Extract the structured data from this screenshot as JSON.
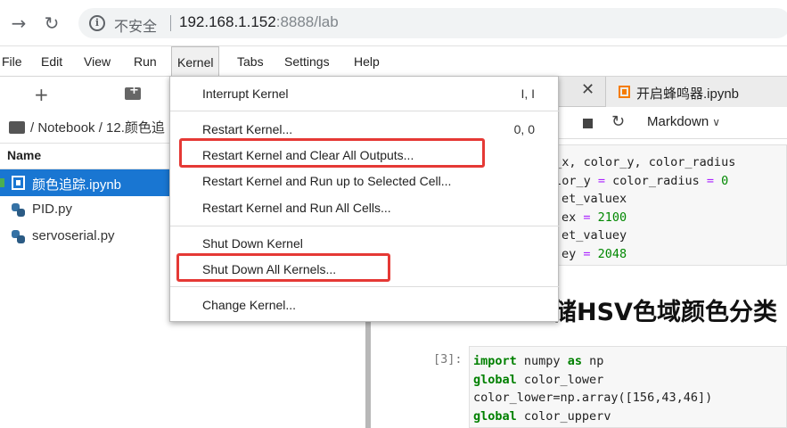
{
  "browser": {
    "not_secure": "不安全",
    "url_host": "192.168.1.152",
    "url_port": ":8888/lab"
  },
  "menubar": {
    "items": [
      "File",
      "Edit",
      "View",
      "Run",
      "Kernel",
      "Tabs",
      "Settings",
      "Help"
    ]
  },
  "filebrowser": {
    "breadcrumb": "/ Notebook / 12.颜色追",
    "header_name": "Name",
    "files": [
      {
        "name": "颜色追踪.ipynb",
        "type": "notebook"
      },
      {
        "name": "PID.py",
        "type": "python"
      },
      {
        "name": "servoserial.py",
        "type": "python"
      }
    ]
  },
  "tabs": {
    "active_label": "开启蜂鸣器.ipynb"
  },
  "notebook_toolbar": {
    "cell_type": "Markdown"
  },
  "notebook": {
    "code_cell_1": [
      {
        "t": "r_x, color_y, color_radius"
      },
      {
        "t": "olor_y ",
        "eq": "=",
        "t2": " color_radius ",
        "eq2": "=",
        "n": " 0"
      },
      {
        "t": "et_valuex"
      },
      {
        "t": "ex ",
        "eq": "=",
        "n": " 2100"
      },
      {
        "t": "et_valuey"
      },
      {
        "t": "ey ",
        "eq": "=",
        "n": " 2048"
      }
    ],
    "heading": "储HSV色域颜色分类",
    "prompt": "[3]:",
    "code_cell_2": {
      "line1_kw": "import",
      "line1_rest": " numpy ",
      "line1_kw2": "as",
      "line1_rest2": " np",
      "line2_kw": "global",
      "line2_rest": " color_lower",
      "line3": "color_lower=np.array([156,43,46])",
      "line4_kw": "global",
      "line4_rest": " color_upperv"
    }
  },
  "kernel_menu": {
    "items": [
      {
        "label": "Interrupt Kernel",
        "shortcut": "I, I"
      },
      {
        "label": "Restart Kernel...",
        "shortcut": "0, 0"
      },
      {
        "label": "Restart Kernel and Clear All Outputs...",
        "shortcut": ""
      },
      {
        "label": "Restart Kernel and Run up to Selected Cell...",
        "shortcut": ""
      },
      {
        "label": "Restart Kernel and Run All Cells...",
        "shortcut": ""
      },
      {
        "label": "Shut Down Kernel",
        "shortcut": ""
      },
      {
        "label": "Shut Down All Kernels...",
        "shortcut": ""
      },
      {
        "label": "Change Kernel...",
        "shortcut": ""
      }
    ]
  },
  "colors": {
    "highlight_box": "#e53935",
    "selected_row": "#1976d2",
    "notebook_tab_icon": "#f57c00"
  }
}
